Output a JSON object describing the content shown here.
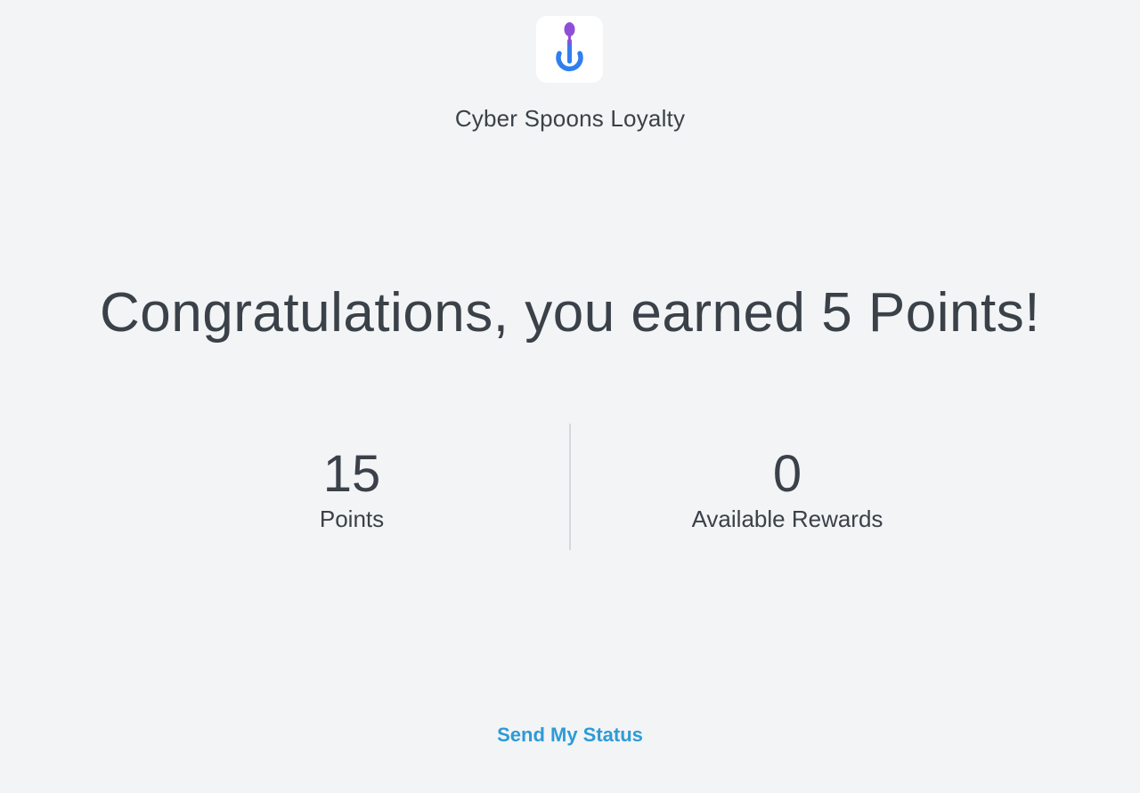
{
  "brand": {
    "name": "Cyber Spoons Loyalty",
    "logo_icon": "spoon-power-icon",
    "logo_colors": {
      "spoon": "#8e4fd6",
      "ring": "#2f7ff0"
    }
  },
  "headline": "Congratulations, you earned 5 Points!",
  "stats": {
    "points": {
      "value": "15",
      "label": "Points"
    },
    "rewards": {
      "value": "0",
      "label": "Available Rewards"
    }
  },
  "actions": {
    "send_status_label": "Send My Status"
  },
  "colors": {
    "background": "#f2f4f6",
    "text": "#3b4148",
    "link": "#2e9bd6"
  }
}
